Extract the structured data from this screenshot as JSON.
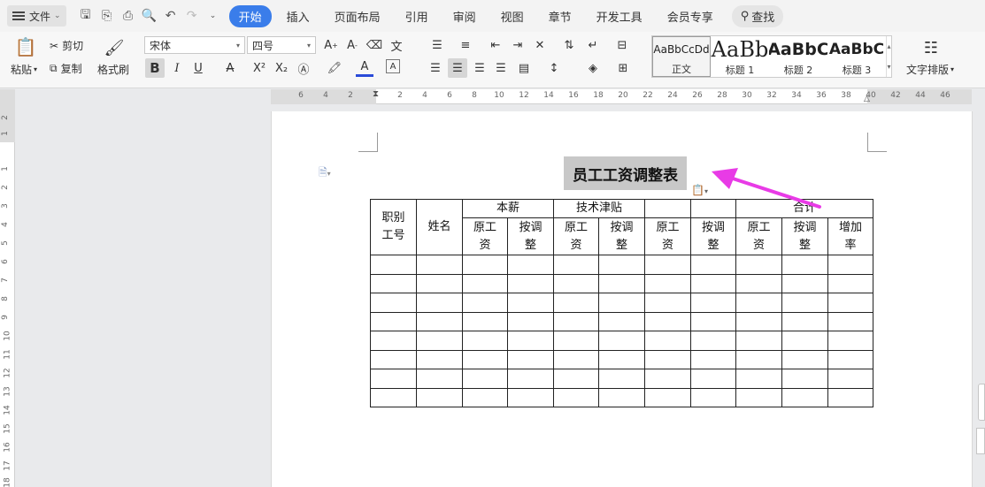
{
  "menubar": {
    "file_label": "文件",
    "tabs": [
      "开始",
      "插入",
      "页面布局",
      "引用",
      "审阅",
      "视图",
      "章节",
      "开发工具",
      "会员专享"
    ],
    "active_tab": "开始",
    "search_label": "查找"
  },
  "ribbon": {
    "paste": "粘贴",
    "cut": "剪切",
    "copy": "复制",
    "format_painter": "格式刷",
    "font_name": "宋体",
    "font_size": "四号",
    "styles": [
      {
        "preview": "AaBbCcDd",
        "name": "正文"
      },
      {
        "preview": "AaBb",
        "name": "标题 1"
      },
      {
        "preview": "AaBbC",
        "name": "标题 2"
      },
      {
        "preview": "AaBbC",
        "name": "标题 3"
      }
    ],
    "text_layout": "文字排版"
  },
  "ruler": {
    "h_ticks": [
      "6",
      "4",
      "2",
      "2",
      "4",
      "6",
      "8",
      "10",
      "12",
      "14",
      "16",
      "18",
      "20",
      "22",
      "24",
      "26",
      "28",
      "30",
      "32",
      "34",
      "36",
      "38",
      "40",
      "42",
      "44",
      "46"
    ],
    "v_ticks": [
      "2",
      "1",
      "1",
      "2",
      "3",
      "4",
      "5",
      "6",
      "7",
      "8",
      "9",
      "10",
      "11",
      "12",
      "13",
      "14",
      "15",
      "16",
      "17",
      "18"
    ]
  },
  "document": {
    "title": "员工工资调整表",
    "table": {
      "header_row1": {
        "id_name": "职别工号",
        "name": "姓名",
        "base_pay": "本薪",
        "tech_allowance": "技术津贴",
        "total": "合计"
      },
      "header_row2": [
        "原工资",
        "按调整",
        "原工资",
        "按调整",
        "原工资",
        "按调整",
        "原工资",
        "按调整",
        "增加率"
      ],
      "empty_rows": 8
    }
  },
  "colors": {
    "accent": "#3a7dea",
    "arrow": "#e83be6"
  }
}
